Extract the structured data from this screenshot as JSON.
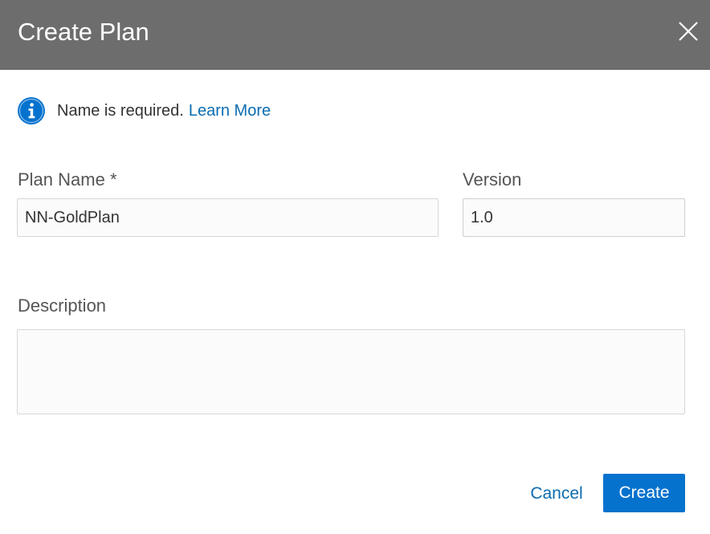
{
  "dialog": {
    "title": "Create Plan",
    "close_icon": "close-icon"
  },
  "info": {
    "icon": "info-icon",
    "message": "Name is required.",
    "link_label": "Learn More",
    "accent_color": "#0572ce"
  },
  "form": {
    "plan_name": {
      "label": "Plan Name *",
      "value": "NN-GoldPlan"
    },
    "version": {
      "label": "Version",
      "value": "1.0"
    },
    "description": {
      "label": "Description",
      "value": ""
    }
  },
  "actions": {
    "cancel_label": "Cancel",
    "create_label": "Create",
    "primary_color": "#0572ce"
  },
  "colors": {
    "header_bg": "#6d6d6d",
    "link": "#0b6cb0"
  }
}
